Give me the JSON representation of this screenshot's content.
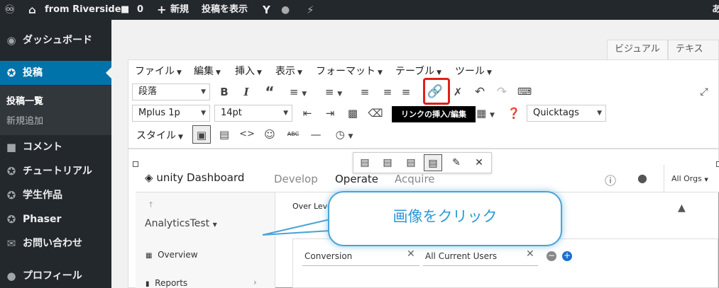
{
  "admin_bar": {
    "site_name": "from Riverside",
    "comments_count": "0",
    "new_label": "新規",
    "view_post": "投稿を表示"
  },
  "sidebar": {
    "items": [
      {
        "label": "ダッシュボード",
        "icon": "dashboard-icon"
      },
      {
        "label": "投稿",
        "icon": "pin-icon"
      },
      {
        "label": "コメント",
        "icon": "comment-icon"
      },
      {
        "label": "チュートリアル",
        "icon": "pin-icon"
      },
      {
        "label": "学生作品",
        "icon": "pin-icon"
      },
      {
        "label": "Phaser",
        "icon": "pin-icon"
      },
      {
        "label": "お問い合わせ",
        "icon": "mail-icon"
      },
      {
        "label": "プロフィール",
        "icon": "user-icon"
      }
    ],
    "submenu": [
      "投稿一覧",
      "新規追加"
    ]
  },
  "editor": {
    "tabs": [
      "ビジュアル",
      "テキスト"
    ],
    "menus": [
      "ファイル",
      "編集",
      "挿入",
      "表示",
      "フォーマット",
      "テーブル",
      "ツール"
    ],
    "format_select": "段落",
    "font_select": "Mplus 1p",
    "size_select": "14pt",
    "quicktags_select": "Quicktags",
    "style_menu": "スタイル",
    "tooltip": "リンクの挿入/編集"
  },
  "dashboard": {
    "logo": "unity Dashboard",
    "nav": [
      "Develop",
      "Operate",
      "Acquire"
    ],
    "orgs": "All Orgs",
    "project": "AnalyticsTest",
    "over_level": "Over Level",
    "left_items": [
      "Overview",
      "Reports"
    ],
    "conversion": "Conversion",
    "segment": "All Current Users"
  },
  "callout": {
    "text": "画像をクリック"
  }
}
